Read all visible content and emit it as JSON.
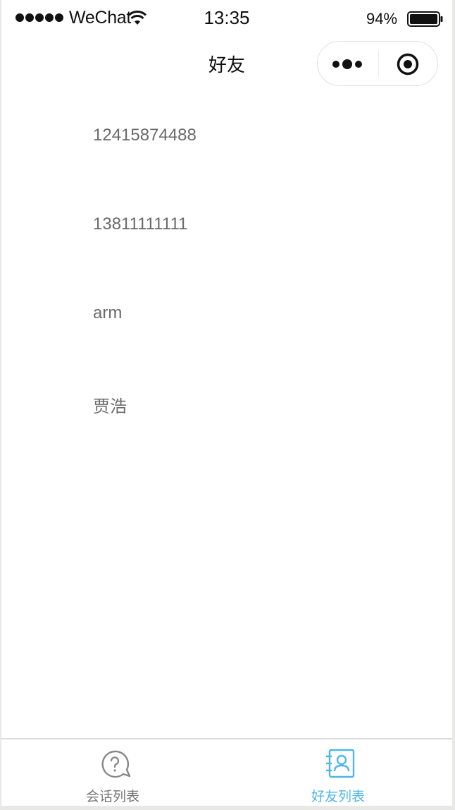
{
  "status_bar": {
    "carrier": "WeChat",
    "time": "13:35",
    "battery": "94%"
  },
  "nav": {
    "title": "好友"
  },
  "friends": [
    {
      "name": "12415874488"
    },
    {
      "name": "13811111111"
    },
    {
      "name": "arm"
    },
    {
      "name": "贾浩"
    }
  ],
  "tab_bar": {
    "tabs": [
      {
        "label": "会话列表",
        "icon": "chat-question-icon",
        "active": false
      },
      {
        "label": "好友列表",
        "icon": "contacts-icon",
        "active": true
      }
    ],
    "active_color": "#4fb7e8",
    "inactive_color": "#777777"
  }
}
